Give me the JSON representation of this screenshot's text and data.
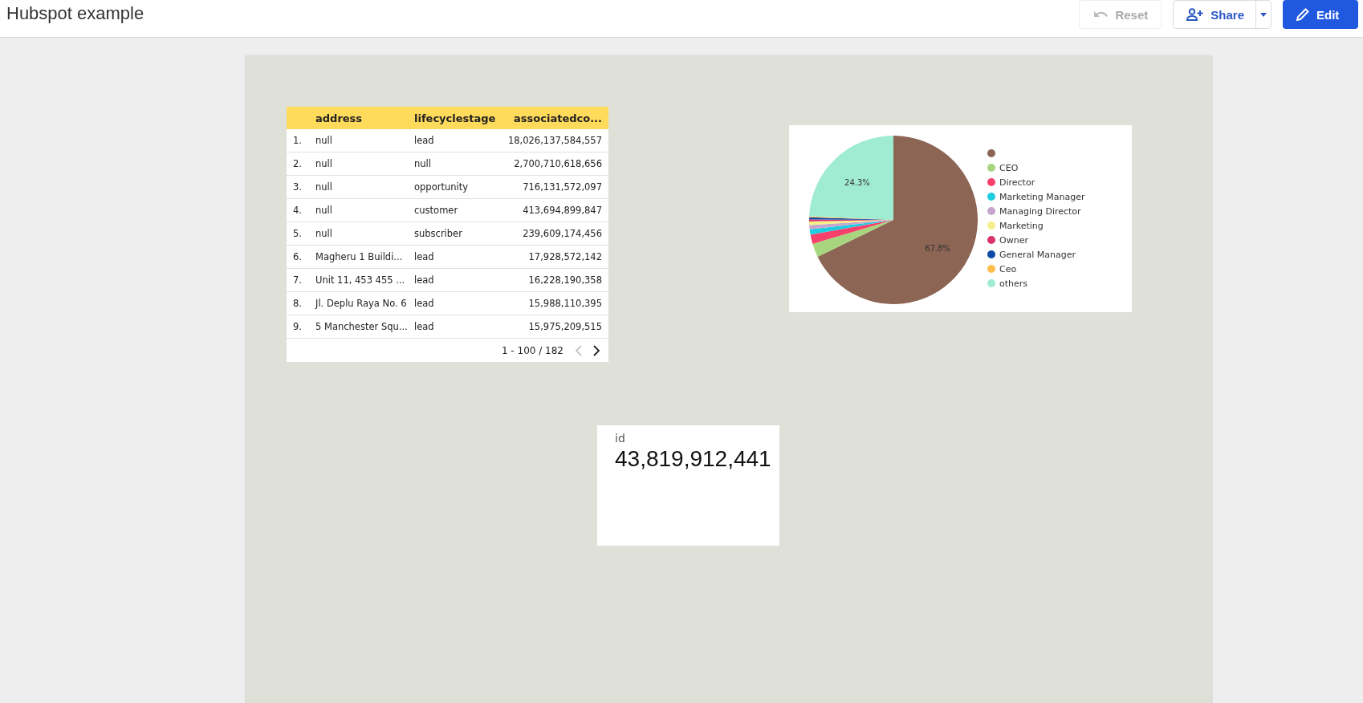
{
  "header": {
    "title": "Hubspot example",
    "buttons": [
      {
        "kind": "reset",
        "label": "Reset",
        "disabled": true
      },
      {
        "kind": "share",
        "label": "Share"
      },
      {
        "kind": "edit",
        "label": "Edit"
      }
    ]
  },
  "table": {
    "columns": [
      "address",
      "lifecyclestage",
      "associatedco..."
    ],
    "rows": [
      {
        "index": "1.",
        "cells": [
          "null",
          "lead",
          "18,026,137,584,557"
        ]
      },
      {
        "index": "2.",
        "cells": [
          "null",
          "null",
          "2,700,710,618,656"
        ]
      },
      {
        "index": "3.",
        "cells": [
          "null",
          "opportunity",
          "716,131,572,097"
        ]
      },
      {
        "index": "4.",
        "cells": [
          "null",
          "customer",
          "413,694,899,847"
        ]
      },
      {
        "index": "5.",
        "cells": [
          "null",
          "subscriber",
          "239,609,174,456"
        ]
      },
      {
        "index": "6.",
        "cells": [
          "Magheru 1 Buildi...",
          "lead",
          "17,928,572,142"
        ]
      },
      {
        "index": "7.",
        "cells": [
          "Unit 11, 453 455 ...",
          "lead",
          "16,228,190,358"
        ]
      },
      {
        "index": "8.",
        "cells": [
          "Jl. Deplu Raya No. 6",
          "lead",
          "15,988,110,395"
        ]
      },
      {
        "index": "9.",
        "cells": [
          "5 Manchester Squ...",
          "lead",
          "15,975,209,515"
        ]
      }
    ],
    "pagination": "1 - 100 / 182"
  },
  "pie": {
    "chart_data": {
      "type": "pie",
      "categories": [
        null,
        "CEO",
        "Director",
        "Marketing Manager",
        "Managing Director",
        "Marketing",
        "Owner",
        "General Manager",
        "Ceo",
        "others"
      ],
      "values": [
        67.8,
        2.6,
        1.8,
        1.0,
        0.8,
        0.7,
        0.4,
        0.4,
        0.2,
        24.3
      ],
      "colors": [
        "#8d6554",
        "#a8d67e",
        "#f7416c",
        "#1fcde0",
        "#c6a6cc",
        "#f5ef8a",
        "#d9346e",
        "#0d4aa8",
        "#ffbe4d",
        "#a0ecd2"
      ],
      "value_labels": [
        "67.8%",
        null,
        null,
        null,
        null,
        null,
        null,
        null,
        null,
        "24.3%"
      ],
      "legend": true
    }
  },
  "scorecard": {
    "label": "id",
    "value": "43,819,912,441"
  }
}
